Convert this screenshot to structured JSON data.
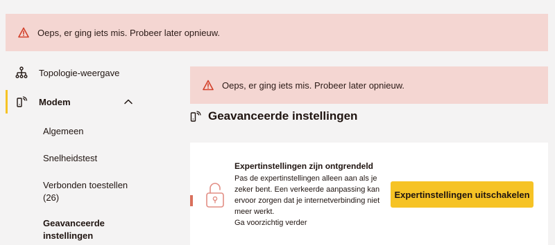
{
  "banners": {
    "top_message": "Oeps, er ging iets mis. Probeer later opnieuw.",
    "main_message": "Oeps, er ging iets mis. Probeer later opnieuw.",
    "icon": "warning-triangle-icon",
    "colors": {
      "background": "#f4d6d2",
      "icon": "#d2402a"
    }
  },
  "sidebar": {
    "topology_label": "Topologie-weergave",
    "modem_label": "Modem",
    "modem_expanded": true,
    "sub_items": [
      {
        "label": "Algemeen"
      },
      {
        "label": "Snelheidstest"
      },
      {
        "label": "Verbonden toestellen"
      },
      {
        "label": "(26)"
      },
      {
        "label": "Geavanceerde"
      },
      {
        "label": "instellingen"
      }
    ],
    "active_color": "#f6c325"
  },
  "main": {
    "section_title": "Geavanceerde instellingen",
    "card": {
      "heading": "Expertinstellingen zijn ontgrendeld",
      "lines": [
        "Pas de expertinstellingen alleen aan als je",
        "zeker bent. Een verkeerde aanpassing kan",
        "ervoor zorgen dat je internetverbinding niet",
        "meer werkt.",
        "Ga voorzichtig verder"
      ],
      "button_label": "Expertinstellingen uitschakelen",
      "button_color": "#f6c325",
      "icon": "unlocked-padlock-icon"
    }
  }
}
